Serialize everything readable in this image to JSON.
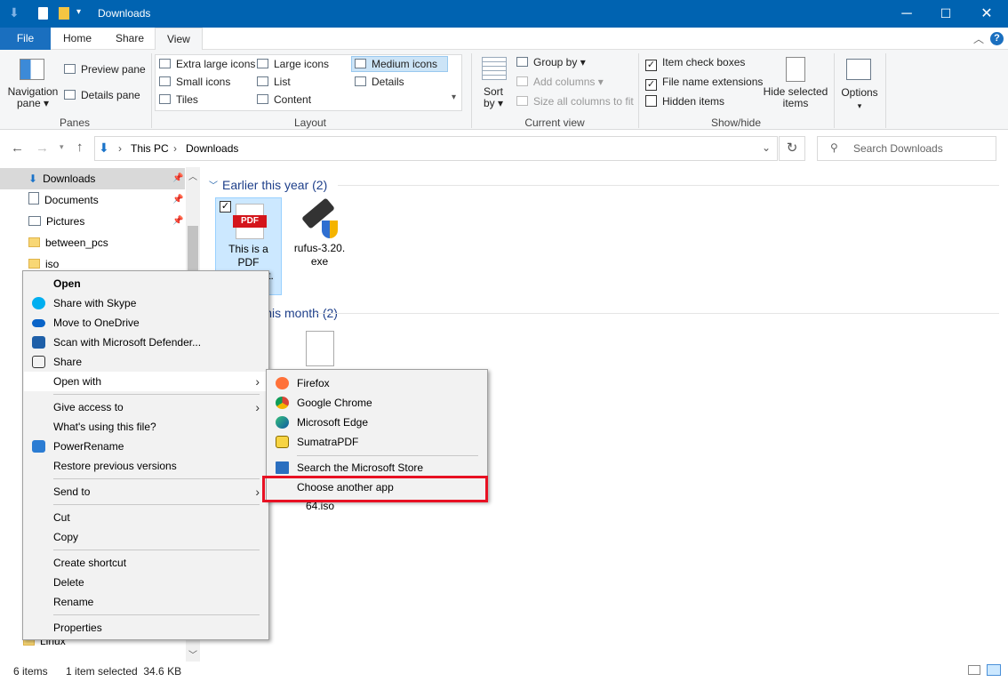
{
  "window": {
    "title": "Downloads",
    "minimize": "─",
    "maximize": "☐",
    "close": "✕"
  },
  "tabs": [
    {
      "label": "File"
    },
    {
      "label": "Home"
    },
    {
      "label": "Share"
    },
    {
      "label": "View"
    }
  ],
  "ribbon": {
    "panes": {
      "group": "Panes",
      "navigation_pane": "Navigation pane ▾",
      "preview_pane": "Preview pane",
      "details_pane": "Details pane"
    },
    "layout": {
      "group": "Layout",
      "items": [
        "Extra large icons",
        "Large icons",
        "Medium icons",
        "Small icons",
        "List",
        "Details",
        "Tiles",
        "Content"
      ],
      "selected": "Medium icons"
    },
    "current_view": {
      "group": "Current view",
      "sort_by": "Sort by ▾",
      "group_by": "Group by ▾",
      "add_columns": "Add columns ▾",
      "size_columns": "Size all columns to fit"
    },
    "show_hide": {
      "group": "Show/hide",
      "item_check_boxes": "Item check boxes",
      "item_check_boxes_checked": true,
      "file_name_extensions": "File name extensions",
      "file_name_extensions_checked": true,
      "hidden_items": "Hidden items",
      "hidden_items_checked": false,
      "hide_selected": "Hide selected items"
    },
    "options": "Options"
  },
  "address": {
    "crumbs": [
      "This PC",
      "Downloads"
    ],
    "search_placeholder": "Search Downloads"
  },
  "nav": {
    "items": [
      "Downloads",
      "Documents",
      "Pictures",
      "between_pcs",
      "iso",
      "Linux"
    ]
  },
  "content": {
    "groups": [
      {
        "title": "Earlier this year (2)"
      },
      {
        "title": "Earlier this month (2)",
        "visible": "nth (2)"
      }
    ],
    "files": [
      {
        "name": "This is a PDF ...t.",
        "line1": "This is a",
        "line2": "PDF",
        "line3": "t.",
        "selected": true
      },
      {
        "name": "rufus-3.20.exe",
        "line1": "rufus-3.20.",
        "line2": "exe"
      },
      {
        "name": "64.iso"
      }
    ]
  },
  "context_menu": {
    "items": [
      "Open",
      "Share with Skype",
      "Move to OneDrive",
      "Scan with Microsoft Defender...",
      "Share",
      "Open with",
      "Give access to",
      "What's using this file?",
      "PowerRename",
      "Restore previous versions",
      "Send to",
      "Cut",
      "Copy",
      "Create shortcut",
      "Delete",
      "Rename",
      "Properties"
    ]
  },
  "submenu": {
    "items": [
      "Firefox",
      "Google Chrome",
      "Microsoft Edge",
      "SumatraPDF",
      "Search the Microsoft Store",
      "Choose another app"
    ],
    "highlight_color": "#e81123"
  },
  "status": {
    "count": "6 items",
    "selected": "1 item selected  34.6 KB"
  }
}
